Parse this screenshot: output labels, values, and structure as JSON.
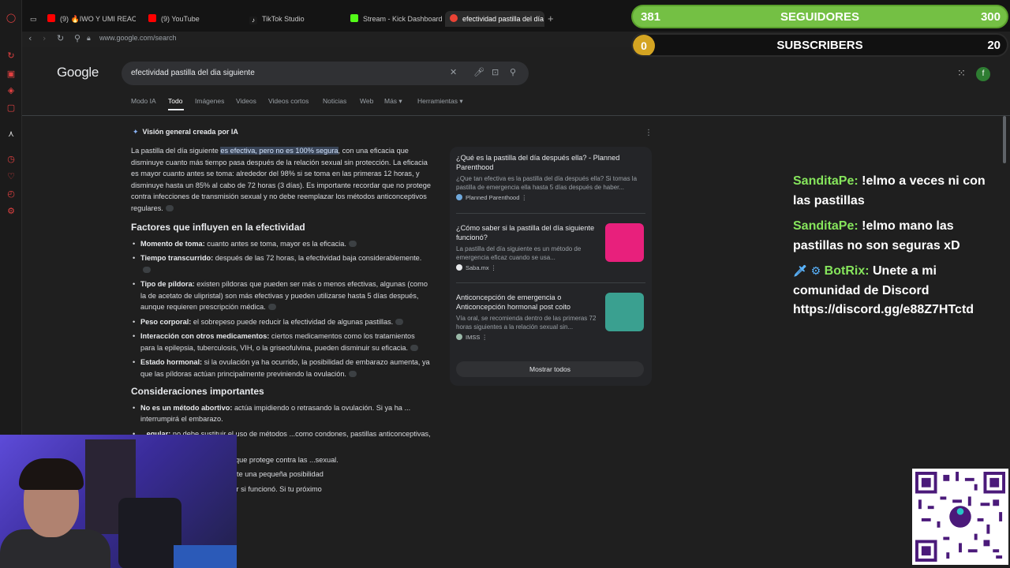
{
  "browser": {
    "tabs": [
      {
        "label": "(9) 🔥IWO Y UMI REACCI",
        "favicon_color": "#ff0000"
      },
      {
        "label": "(9) YouTube",
        "favicon_color": "#ff0000"
      },
      {
        "label": "TikTok Studio",
        "favicon_color": "#ffffff"
      },
      {
        "label": "Stream - Kick Dashboard",
        "favicon_color": "#53fc18"
      },
      {
        "label": "efectividad pastilla del día",
        "favicon_color": "#ea4335"
      }
    ],
    "url": "www.google.com/search"
  },
  "google": {
    "logo": "Google",
    "query": "efectividad pastilla del dia siguiente",
    "tabs": [
      "Modo IA",
      "Todo",
      "Imágenes",
      "Videos",
      "Videos cortos",
      "Noticias",
      "Web",
      "Más",
      "Herramientas"
    ],
    "active_tab": "Todo",
    "avatar_letter": "f"
  },
  "ai_overview": {
    "heading": "Visión general creada por IA",
    "intro_pre": "La pastilla del día siguiente ",
    "intro_hl": "es efectiva, pero no es 100% segura",
    "intro_post": ", con una eficacia que disminuye cuanto más tiempo pasa después de la relación sexual sin protección. La eficacia es mayor cuanto antes se toma: alrededor del 98% si se toma en las primeras 12 horas, y disminuye hasta un 85% al cabo de 72 horas (3 días). Es importante recordar que no protege contra infecciones de transmisión sexual y no debe reemplazar los métodos anticonceptivos regulares.",
    "section1": "Factores que influyen en la efectividad",
    "factors": [
      {
        "title": "Momento de toma:",
        "text": " cuanto antes se toma, mayor es la eficacia."
      },
      {
        "title": "Tiempo transcurrido:",
        "text": " después de las 72 horas, la efectividad baja considerablemente."
      },
      {
        "title": "Tipo de píldora:",
        "text": " existen píldoras que pueden ser más o menos efectivas, algunas (como la de acetato de ulipristal) son más efectivas y pueden utilizarse hasta 5 días después, aunque requieren prescripción médica."
      },
      {
        "title": "Peso corporal:",
        "text": " el sobrepeso puede reducir la efectividad de algunas pastillas."
      },
      {
        "title": "Interacción con otros medicamentos:",
        "text": " ciertos medicamentos como los tratamientos para la epilepsia, tuberculosis, VIH, o la griseofulvina, pueden disminuir su eficacia."
      },
      {
        "title": "Estado hormonal:",
        "text": " si la ovulación ya ha ocurrido, la posibilidad de embarazo aumenta, ya que las píldoras actúan principalmente previniendo la ovulación."
      }
    ],
    "section2": "Consideraciones importantes",
    "considerations": [
      {
        "title": "No es un método abortivo:",
        "text": " actúa impidiendo o retrasando la ovulación. Si ya ha ... interrumpirá el embarazo."
      },
      {
        "title": "...egular:",
        "text": " no debe sustituir el uso de métodos ...como condones, pastillas anticonceptivas, etc.)."
      },
      {
        "title": "",
        "text": "...condón es el único método que protege contra las ...sexual."
      },
      {
        "title": "",
        "text": "...so con un uso correcto, existe una pequeña posibilidad"
      },
      {
        "title": "",
        "text": "...menstruación para confirmar si funcionó. Si tu próximo"
      }
    ]
  },
  "sources": [
    {
      "title": "¿Qué es la pastilla del día después ella? - Planned Parenthood",
      "snippet": "¿Que tan efectiva es la pastilla del día después ella? Si tomas la pastilla de emergencia ella hasta 5 días después de haber...",
      "site": "Planned Parenthood",
      "site_color": "#6fa8dc"
    },
    {
      "title": "¿Cómo saber si la pastilla del día siguiente funcionó?",
      "snippet": "La pastilla del día siguiente es un método de emergencia eficaz cuando se usa...",
      "site": "Saba.mx",
      "site_color": "#e8eaed",
      "thumb_color": "#e8207c"
    },
    {
      "title": "Anticoncepción de emergencia o Anticoncepción hormonal post coito",
      "snippet": "Vía oral, se recomienda dentro de las primeras 72 horas siguientes a la relación sexual sin...",
      "site": "IMSS",
      "site_color": "#9ab8a8",
      "thumb_color": "#3aa090"
    }
  ],
  "show_all": "Mostrar todos",
  "overlay": {
    "followers": {
      "current": "381",
      "label": "SEGUIDORES",
      "goal": "300"
    },
    "subscribers": {
      "current": "0",
      "label": "SUBSCRIBERS",
      "goal": "20"
    },
    "chat": [
      {
        "user": "SanditaPe:",
        "text": " !elmo a veces ni con las pastillas"
      },
      {
        "user": "SanditaPe:",
        "text": " !elmo mano las pastillas no son seguras xD"
      },
      {
        "icons": "🗡 ⚙",
        "user": "BotRix:",
        "text": " Unete a mi comunidad de Discord https://discord.gg/e88Z7HTctd"
      }
    ]
  }
}
